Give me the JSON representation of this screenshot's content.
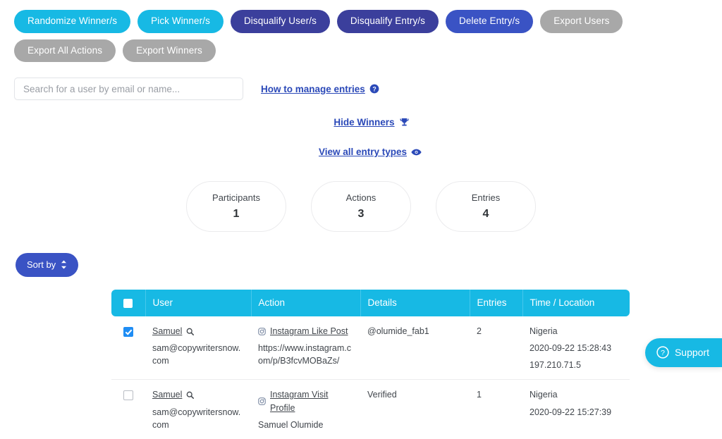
{
  "toolbar": {
    "buttons": [
      {
        "label": "Randomize Winner/s",
        "style": "cyan"
      },
      {
        "label": "Pick Winner/s",
        "style": "cyan"
      },
      {
        "label": "Disqualify User/s",
        "style": "indigo"
      },
      {
        "label": "Disqualify Entry/s",
        "style": "indigo"
      },
      {
        "label": "Delete Entry/s",
        "style": "royal"
      },
      {
        "label": "Export Users",
        "style": "gray"
      },
      {
        "label": "Export All Actions",
        "style": "gray"
      },
      {
        "label": "Export Winners",
        "style": "gray"
      }
    ]
  },
  "search": {
    "placeholder": "Search for a user by email or name...",
    "value": ""
  },
  "links": {
    "how_to_manage": "How to manage entries",
    "how_to_manage_icon": "question-circle-icon",
    "hide_winners": "Hide Winners",
    "hide_winners_icon": "trophy-icon",
    "view_entry_types": "View all entry types",
    "view_entry_types_icon": "eye-icon"
  },
  "stats": [
    {
      "label": "Participants",
      "value": "1"
    },
    {
      "label": "Actions",
      "value": "3"
    },
    {
      "label": "Entries",
      "value": "4"
    }
  ],
  "sort": {
    "label": "Sort by",
    "icon": "up-down-arrows-icon"
  },
  "table": {
    "columns": [
      "User",
      "Action",
      "Details",
      "Entries",
      "Time / Location"
    ],
    "header_checkbox_checked": false,
    "rows": [
      {
        "checked": true,
        "user_name": "Samuel",
        "user_search_icon": "magnifier-icon",
        "user_email": "sam@copywritersnow.com",
        "action_icon": "instagram-icon",
        "action_label": "Instagram Like Post",
        "action_sub": "https://www.instagram.com/p/B3fcvMOBaZs/",
        "details": "@olumide_fab1",
        "entries": "2",
        "time_lines": [
          "Nigeria",
          "2020-09-22 15:28:43",
          "197.210.71.5"
        ]
      },
      {
        "checked": false,
        "user_name": "Samuel",
        "user_search_icon": "magnifier-icon",
        "user_email": "sam@copywritersnow.com",
        "action_icon": "instagram-icon",
        "action_label": "Instagram Visit Profile",
        "action_sub": "Samuel Olumide",
        "details": "Verified",
        "entries": "1",
        "time_lines": [
          "Nigeria",
          "2020-09-22 15:27:39"
        ]
      }
    ]
  },
  "support": {
    "label": "Support",
    "icon": "question-circle-icon"
  },
  "colors": {
    "cyan": "#17b9e4",
    "indigo": "#3b3f9c",
    "royal": "#3a53c4",
    "gray": "#a8a8a8",
    "link_blue": "#2b49b8",
    "checkbox_blue": "#1f8df4"
  }
}
